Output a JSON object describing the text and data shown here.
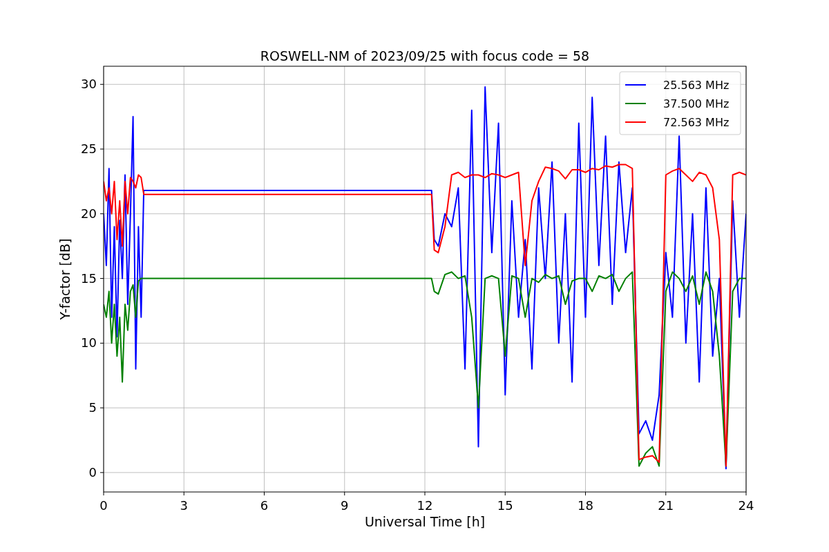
{
  "figure": {
    "chart_data": {
      "type": "line",
      "title": "ROSWELL-NM of 2023/09/25 with focus code = 58",
      "xlabel": "Universal Time [h]",
      "ylabel": "Y-factor [dB]",
      "x": [
        0,
        0.1,
        0.2,
        0.3,
        0.4,
        0.5,
        0.6,
        0.7,
        0.8,
        0.9,
        1.0,
        1.1,
        1.2,
        1.3,
        1.4,
        1.5,
        12.25,
        12.35,
        12.5,
        12.75,
        13,
        13.25,
        13.5,
        13.75,
        14,
        14.25,
        14.5,
        14.75,
        15,
        15.25,
        15.5,
        15.75,
        16,
        16.25,
        16.5,
        16.75,
        17,
        17.25,
        17.5,
        17.75,
        18,
        18.25,
        18.5,
        18.75,
        19,
        19.25,
        19.5,
        19.75,
        20,
        20.25,
        20.5,
        20.75,
        21,
        21.25,
        21.5,
        21.75,
        22,
        22.25,
        22.5,
        22.75,
        23,
        23.25,
        23.5,
        23.75,
        24
      ],
      "series": [
        {
          "name": "25.563 MHz",
          "color": "#0000ff",
          "values": [
            20,
            16,
            23.5,
            12,
            19,
            10.5,
            19.5,
            15,
            23,
            13,
            20,
            27.5,
            8,
            19,
            12,
            21.8,
            21.8,
            18,
            17.5,
            20,
            19,
            22,
            8,
            28,
            2,
            29.8,
            17,
            27,
            6,
            21,
            12,
            18,
            8,
            22,
            15,
            24,
            10,
            20,
            7,
            27,
            12,
            29,
            16,
            26,
            13,
            24,
            17,
            22,
            3,
            4,
            2.5,
            6,
            17,
            12,
            26,
            10,
            20,
            7,
            22,
            9,
            15,
            0.3,
            21,
            12,
            20
          ]
        },
        {
          "name": "37.500 MHz",
          "color": "#008000",
          "values": [
            13,
            12,
            14,
            10,
            13,
            9,
            12,
            7,
            13,
            11,
            14,
            14.5,
            12,
            14.8,
            15,
            15,
            15,
            14,
            13.8,
            15.3,
            15.5,
            15,
            15.2,
            12,
            5,
            15,
            15.2,
            15,
            9,
            15.2,
            15,
            12,
            15,
            14.7,
            15.3,
            15,
            15.2,
            13,
            14.8,
            15,
            15,
            14,
            15.2,
            15,
            15.3,
            14,
            15,
            15.5,
            0.5,
            1.5,
            2,
            0.5,
            14,
            15.5,
            15,
            14,
            15.2,
            13,
            15.5,
            14,
            9,
            0.5,
            14,
            15,
            15
          ]
        },
        {
          "name": "72.563 MHz",
          "color": "#ff0000",
          "values": [
            22.5,
            21,
            22,
            20,
            22.5,
            18,
            21,
            17.5,
            22.5,
            20,
            22.8,
            22.5,
            22,
            23,
            22.8,
            21.5,
            21.5,
            17.2,
            17,
            19,
            23,
            23.2,
            22.8,
            23,
            23,
            22.8,
            23.1,
            23,
            22.8,
            23,
            23.2,
            16,
            21,
            22.5,
            23.6,
            23.5,
            23.3,
            22.7,
            23.4,
            23.4,
            23.2,
            23.5,
            23.4,
            23.7,
            23.6,
            23.8,
            23.8,
            23.5,
            1,
            1.2,
            1.3,
            0.8,
            23,
            23.3,
            23.5,
            23,
            22.5,
            23.2,
            23,
            22,
            18,
            0.5,
            23,
            23.2,
            23
          ]
        }
      ],
      "grid": true,
      "legend": true,
      "xlim": [
        0,
        24
      ],
      "ylim": [
        -1.5,
        31.4
      ],
      "xticks": [
        0,
        3,
        6,
        9,
        12,
        15,
        18,
        21,
        24
      ],
      "yticks": [
        0,
        5,
        10,
        15,
        20,
        25,
        30
      ]
    }
  }
}
